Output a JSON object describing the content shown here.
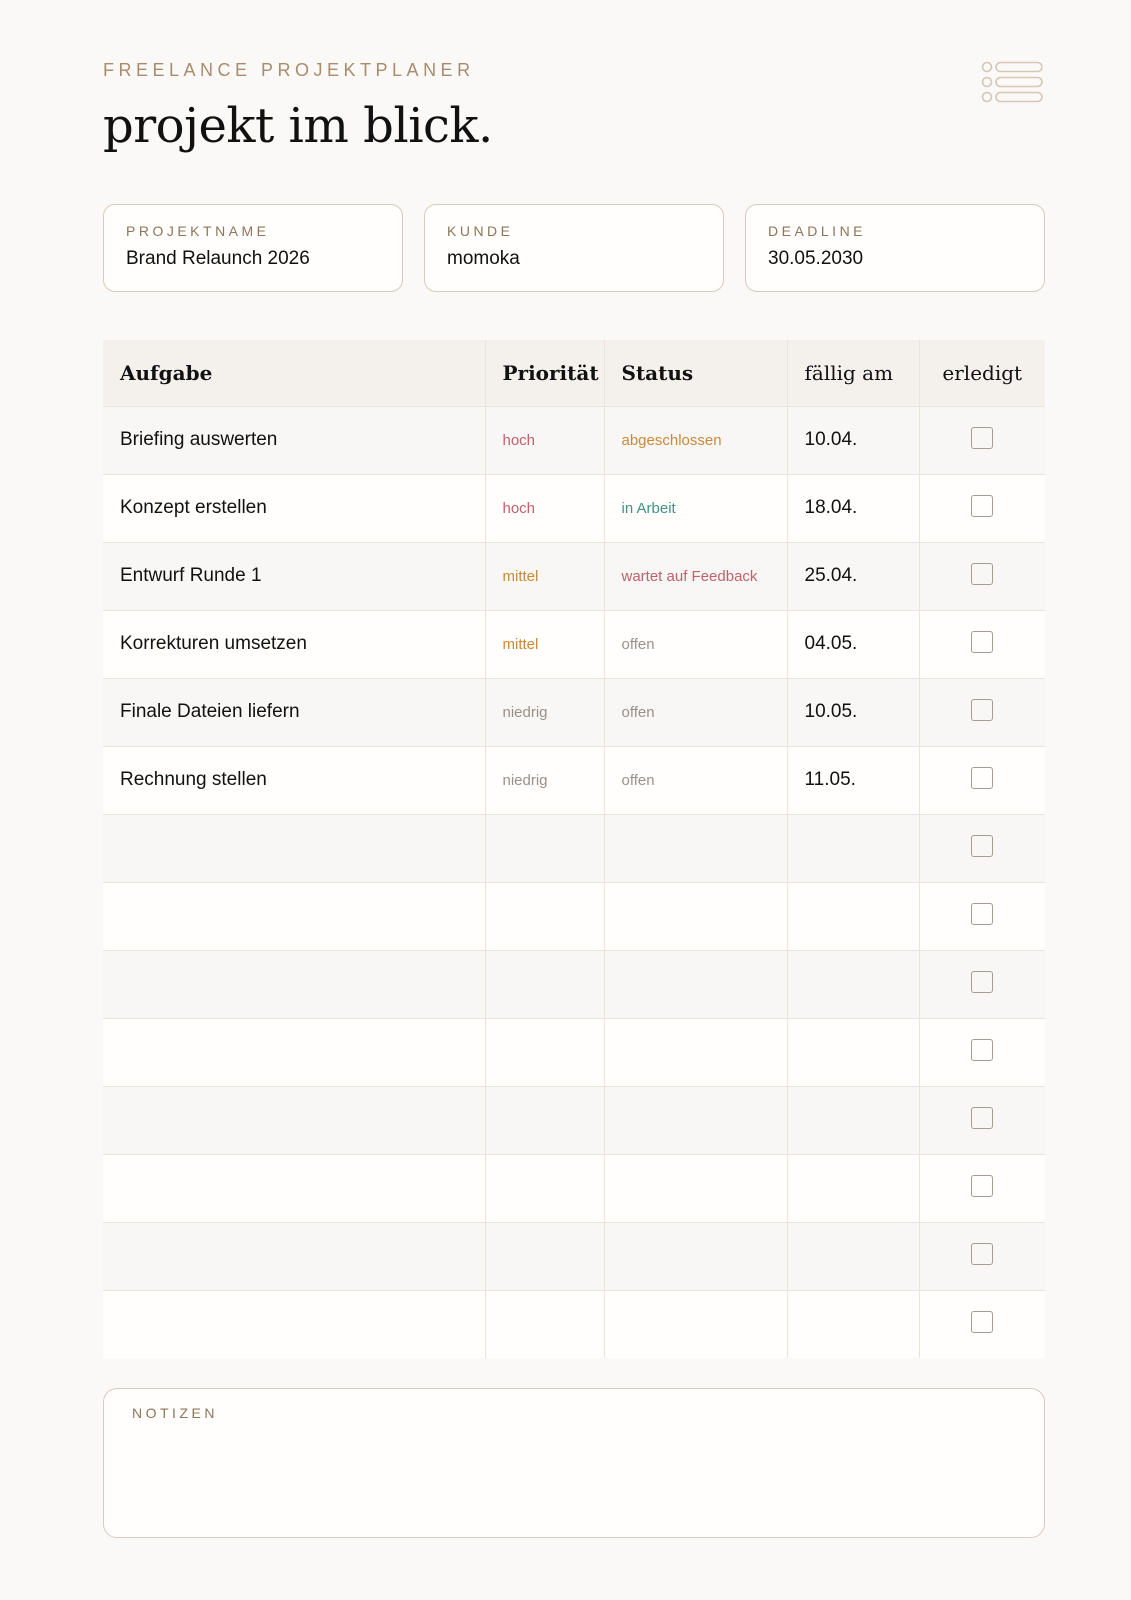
{
  "header": {
    "eyebrow": "FREELANCE PROJEKTPLANER",
    "title": "projekt im blick.",
    "icon": "list-icon"
  },
  "cards": [
    {
      "label": "PROJEKTNAME",
      "value": "Brand Relaunch 2026"
    },
    {
      "label": "KUNDE",
      "value": "momoka"
    },
    {
      "label": "DEADLINE",
      "value": "30.05.2030"
    }
  ],
  "table": {
    "columns": [
      "Aufgabe",
      "Priorität",
      "Status",
      "fällig am",
      "erledigt"
    ],
    "rows": [
      {
        "task": "Briefing auswerten",
        "priority": "hoch",
        "status": "abgeschlossen",
        "due": "10.04.",
        "done": false
      },
      {
        "task": "Konzept erstellen",
        "priority": "hoch",
        "status": "in Arbeit",
        "due": "18.04.",
        "done": false
      },
      {
        "task": "Entwurf Runde 1",
        "priority": "mittel",
        "status": "wartet auf Feedback",
        "due": "25.04.",
        "done": false
      },
      {
        "task": "Korrekturen umsetzen",
        "priority": "mittel",
        "status": "offen",
        "due": "04.05.",
        "done": false
      },
      {
        "task": "Finale Dateien liefern",
        "priority": "niedrig",
        "status": "offen",
        "due": "10.05.",
        "done": false
      },
      {
        "task": "Rechnung stellen",
        "priority": "niedrig",
        "status": "offen",
        "due": "11.05.",
        "done": false
      }
    ],
    "empty_rows": 8
  },
  "colors": {
    "priority_hoch": "#c2606a",
    "priority_mittel": "#c9893a",
    "priority_niedrig": "#9a9089",
    "status_abgeschlossen": "#c9893a",
    "status_in_arbeit": "#3f9286",
    "status_wartet": "#c2606a",
    "status_offen": "#9a9089",
    "accent": "#a98c6c"
  },
  "notes": {
    "label": "NOTIZEN",
    "value": ""
  }
}
